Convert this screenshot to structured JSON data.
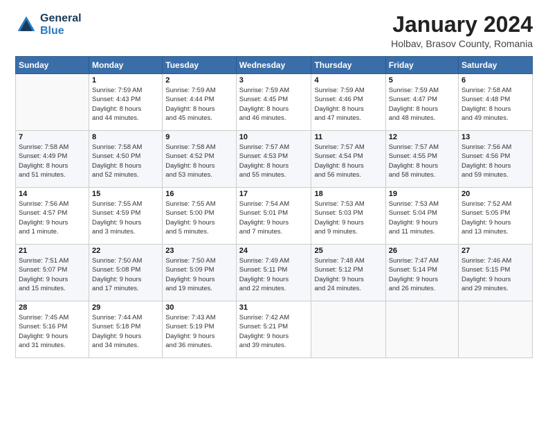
{
  "header": {
    "logo_line1": "General",
    "logo_line2": "Blue",
    "month": "January 2024",
    "location": "Holbav, Brasov County, Romania"
  },
  "weekdays": [
    "Sunday",
    "Monday",
    "Tuesday",
    "Wednesday",
    "Thursday",
    "Friday",
    "Saturday"
  ],
  "weeks": [
    [
      {
        "day": "",
        "info": ""
      },
      {
        "day": "1",
        "info": "Sunrise: 7:59 AM\nSunset: 4:43 PM\nDaylight: 8 hours\nand 44 minutes."
      },
      {
        "day": "2",
        "info": "Sunrise: 7:59 AM\nSunset: 4:44 PM\nDaylight: 8 hours\nand 45 minutes."
      },
      {
        "day": "3",
        "info": "Sunrise: 7:59 AM\nSunset: 4:45 PM\nDaylight: 8 hours\nand 46 minutes."
      },
      {
        "day": "4",
        "info": "Sunrise: 7:59 AM\nSunset: 4:46 PM\nDaylight: 8 hours\nand 47 minutes."
      },
      {
        "day": "5",
        "info": "Sunrise: 7:59 AM\nSunset: 4:47 PM\nDaylight: 8 hours\nand 48 minutes."
      },
      {
        "day": "6",
        "info": "Sunrise: 7:58 AM\nSunset: 4:48 PM\nDaylight: 8 hours\nand 49 minutes."
      }
    ],
    [
      {
        "day": "7",
        "info": "Sunrise: 7:58 AM\nSunset: 4:49 PM\nDaylight: 8 hours\nand 51 minutes."
      },
      {
        "day": "8",
        "info": "Sunrise: 7:58 AM\nSunset: 4:50 PM\nDaylight: 8 hours\nand 52 minutes."
      },
      {
        "day": "9",
        "info": "Sunrise: 7:58 AM\nSunset: 4:52 PM\nDaylight: 8 hours\nand 53 minutes."
      },
      {
        "day": "10",
        "info": "Sunrise: 7:57 AM\nSunset: 4:53 PM\nDaylight: 8 hours\nand 55 minutes."
      },
      {
        "day": "11",
        "info": "Sunrise: 7:57 AM\nSunset: 4:54 PM\nDaylight: 8 hours\nand 56 minutes."
      },
      {
        "day": "12",
        "info": "Sunrise: 7:57 AM\nSunset: 4:55 PM\nDaylight: 8 hours\nand 58 minutes."
      },
      {
        "day": "13",
        "info": "Sunrise: 7:56 AM\nSunset: 4:56 PM\nDaylight: 8 hours\nand 59 minutes."
      }
    ],
    [
      {
        "day": "14",
        "info": "Sunrise: 7:56 AM\nSunset: 4:57 PM\nDaylight: 9 hours\nand 1 minute."
      },
      {
        "day": "15",
        "info": "Sunrise: 7:55 AM\nSunset: 4:59 PM\nDaylight: 9 hours\nand 3 minutes."
      },
      {
        "day": "16",
        "info": "Sunrise: 7:55 AM\nSunset: 5:00 PM\nDaylight: 9 hours\nand 5 minutes."
      },
      {
        "day": "17",
        "info": "Sunrise: 7:54 AM\nSunset: 5:01 PM\nDaylight: 9 hours\nand 7 minutes."
      },
      {
        "day": "18",
        "info": "Sunrise: 7:53 AM\nSunset: 5:03 PM\nDaylight: 9 hours\nand 9 minutes."
      },
      {
        "day": "19",
        "info": "Sunrise: 7:53 AM\nSunset: 5:04 PM\nDaylight: 9 hours\nand 11 minutes."
      },
      {
        "day": "20",
        "info": "Sunrise: 7:52 AM\nSunset: 5:05 PM\nDaylight: 9 hours\nand 13 minutes."
      }
    ],
    [
      {
        "day": "21",
        "info": "Sunrise: 7:51 AM\nSunset: 5:07 PM\nDaylight: 9 hours\nand 15 minutes."
      },
      {
        "day": "22",
        "info": "Sunrise: 7:50 AM\nSunset: 5:08 PM\nDaylight: 9 hours\nand 17 minutes."
      },
      {
        "day": "23",
        "info": "Sunrise: 7:50 AM\nSunset: 5:09 PM\nDaylight: 9 hours\nand 19 minutes."
      },
      {
        "day": "24",
        "info": "Sunrise: 7:49 AM\nSunset: 5:11 PM\nDaylight: 9 hours\nand 22 minutes."
      },
      {
        "day": "25",
        "info": "Sunrise: 7:48 AM\nSunset: 5:12 PM\nDaylight: 9 hours\nand 24 minutes."
      },
      {
        "day": "26",
        "info": "Sunrise: 7:47 AM\nSunset: 5:14 PM\nDaylight: 9 hours\nand 26 minutes."
      },
      {
        "day": "27",
        "info": "Sunrise: 7:46 AM\nSunset: 5:15 PM\nDaylight: 9 hours\nand 29 minutes."
      }
    ],
    [
      {
        "day": "28",
        "info": "Sunrise: 7:45 AM\nSunset: 5:16 PM\nDaylight: 9 hours\nand 31 minutes."
      },
      {
        "day": "29",
        "info": "Sunrise: 7:44 AM\nSunset: 5:18 PM\nDaylight: 9 hours\nand 34 minutes."
      },
      {
        "day": "30",
        "info": "Sunrise: 7:43 AM\nSunset: 5:19 PM\nDaylight: 9 hours\nand 36 minutes."
      },
      {
        "day": "31",
        "info": "Sunrise: 7:42 AM\nSunset: 5:21 PM\nDaylight: 9 hours\nand 39 minutes."
      },
      {
        "day": "",
        "info": ""
      },
      {
        "day": "",
        "info": ""
      },
      {
        "day": "",
        "info": ""
      }
    ]
  ]
}
